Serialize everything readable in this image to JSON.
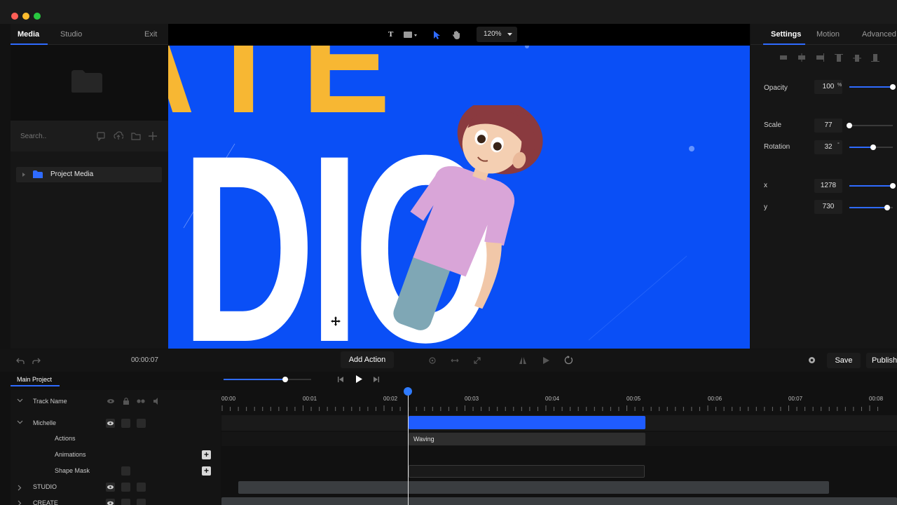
{
  "left_panel": {
    "tabs": [
      {
        "label": "Media"
      },
      {
        "label": "Studio"
      },
      {
        "label": "Exit"
      }
    ],
    "search_placeholder": "Search..",
    "tree_item": "Project Media"
  },
  "canvas": {
    "zoom": "120%",
    "stage_text_top": "ATE",
    "stage_text_main": "DIO"
  },
  "right_panel": {
    "tabs": [
      {
        "label": "Settings"
      },
      {
        "label": "Motion"
      },
      {
        "label": "Advanced"
      }
    ],
    "props": [
      {
        "label": "Opacity",
        "value": "100",
        "unit": "%",
        "level": 1.0
      },
      {
        "label": "Scale",
        "value": "77",
        "unit": "",
        "level": 0.0
      },
      {
        "label": "Rotation",
        "value": "32",
        "unit": "°",
        "level": 0.55
      },
      {
        "label": "x",
        "value": "1278",
        "unit": "",
        "level": 1.0
      },
      {
        "label": "y",
        "value": "730",
        "unit": "",
        "level": 0.87
      }
    ]
  },
  "toolbar": {
    "time": "00:00:07",
    "add_action": "Add Action",
    "save": "Save",
    "publish": "Publish"
  },
  "timeline": {
    "tab": "Main Project",
    "header_label": "Track Name",
    "playback_progress": 0.7,
    "ticks": [
      "00:00",
      "00:01",
      "00:02",
      "00:03",
      "00:04",
      "00:05",
      "00:06",
      "00:07",
      "00:08"
    ],
    "tracks": [
      {
        "label": "Michelle"
      },
      {
        "label": "Actions"
      },
      {
        "label": "Animations"
      },
      {
        "label": "Shape Mask"
      },
      {
        "label": "STUDIO"
      },
      {
        "label": "CREATE"
      }
    ],
    "clip_label": "Waving"
  },
  "colors": {
    "accent": "#2f6bff",
    "stage": "#0a4ff6",
    "yellow_text": "#f7b733"
  }
}
